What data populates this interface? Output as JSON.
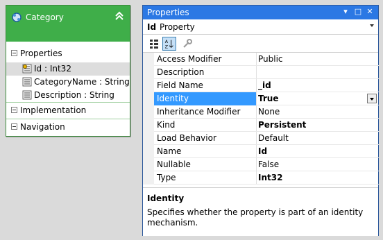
{
  "entity": {
    "title": "Category",
    "sections": {
      "properties": "Properties",
      "implementation": "Implementation",
      "navigation": "Navigation"
    },
    "properties": [
      {
        "label": "Id : Int32",
        "selected": true
      },
      {
        "label": "CategoryName : String",
        "selected": false
      },
      {
        "label": "Description : String",
        "selected": false
      }
    ]
  },
  "properties_window": {
    "title": "Properties",
    "object_name": "Id",
    "object_type": "Property",
    "rows": [
      {
        "name": "Access Modifier",
        "value": "Public"
      },
      {
        "name": "Description",
        "value": ""
      },
      {
        "name": "Field Name",
        "value": "_id"
      },
      {
        "name": "Identity",
        "value": "True",
        "selected": true
      },
      {
        "name": "Inheritance Modifier",
        "value": "None"
      },
      {
        "name": "Kind",
        "value": "Persistent"
      },
      {
        "name": "Load Behavior",
        "value": "Default"
      },
      {
        "name": "Name",
        "value": "Id"
      },
      {
        "name": "Nullable",
        "value": "False"
      },
      {
        "name": "Type",
        "value": "Int32"
      }
    ],
    "description_title": "Identity",
    "description_text": "Specifies whether the property is part of an identity mechanism."
  },
  "colors": {
    "entity_header": "#3fae49",
    "window_title": "#2b78e4",
    "selection": "#3399ff"
  }
}
